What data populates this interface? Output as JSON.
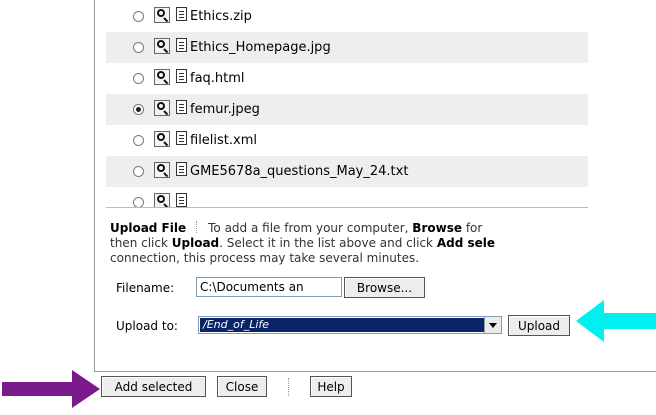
{
  "file_list": {
    "items": [
      {
        "name": "Ethics.zip",
        "selected": false
      },
      {
        "name": "Ethics_Homepage.jpg",
        "selected": false
      },
      {
        "name": "faq.html",
        "selected": false
      },
      {
        "name": "femur.jpeg",
        "selected": true
      },
      {
        "name": "filelist.xml",
        "selected": false
      },
      {
        "name": "GME5678a_questions_May_24.txt",
        "selected": false
      },
      {
        "name": "",
        "selected": false
      }
    ]
  },
  "upload": {
    "heading": "Upload File",
    "line1_pre": "To add a file from your computer,",
    "line1_bold": "Browse",
    "line1_post": "for",
    "line2_pre": "then click",
    "line2_bold1": "Upload",
    "line2_mid": ". Select it in the list above and click",
    "line2_bold2": "Add sele",
    "line3": "connection, this process may take several minutes.",
    "filename_label": "Filename:",
    "filename_value": "C:\\Documents an",
    "browse_label": "Browse...",
    "upload_to_label": "Upload to:",
    "upload_to_value": "/End_of_Life",
    "upload_label": "Upload"
  },
  "footer": {
    "add_selected_label": "Add selected",
    "close_label": "Close",
    "help_label": "Help"
  },
  "annotations": {
    "cyan_arrow_color": "#00f0f0",
    "purple_arrow_color": "#7a1a8c",
    "cyan_arrow_points_to": "upload-button",
    "purple_arrow_points_to": "add-selected-button"
  }
}
